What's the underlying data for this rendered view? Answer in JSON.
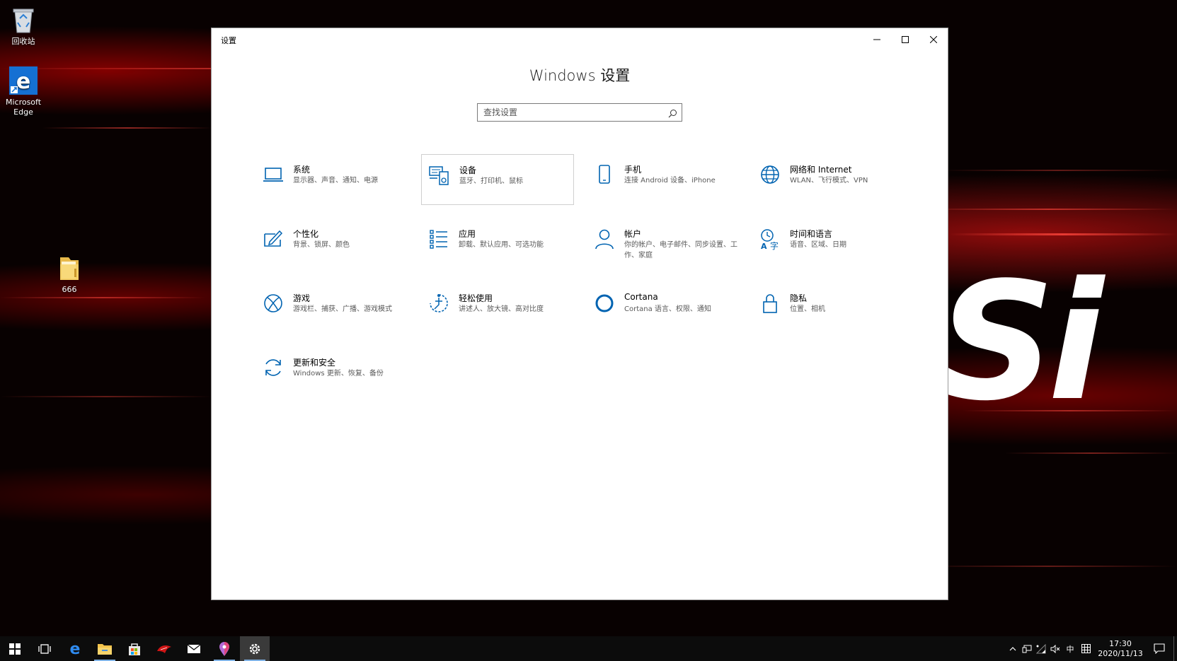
{
  "desktop": {
    "icons": [
      {
        "label": "回收站"
      },
      {
        "label": "Microsoft Edge"
      },
      {
        "label": "666"
      }
    ],
    "wallpaper_brand": "Si"
  },
  "window": {
    "title": "设置",
    "heading": "Windows 设置",
    "search_placeholder": "查找设置",
    "categories": [
      {
        "name": "系统",
        "desc": "显示器、声音、通知、电源",
        "icon": "laptop-icon"
      },
      {
        "name": "设备",
        "desc": "蓝牙、打印机、鼠标",
        "icon": "devices-icon"
      },
      {
        "name": "手机",
        "desc": "连接 Android 设备、iPhone",
        "icon": "phone-icon"
      },
      {
        "name": "网络和 Internet",
        "desc": "WLAN、飞行模式、VPN",
        "icon": "globe-icon"
      },
      {
        "name": "个性化",
        "desc": "背景、锁屏、颜色",
        "icon": "paint-icon"
      },
      {
        "name": "应用",
        "desc": "卸载、默认应用、可选功能",
        "icon": "apps-list-icon"
      },
      {
        "name": "帐户",
        "desc": "你的帐户、电子邮件、同步设置、工作、家庭",
        "icon": "person-icon"
      },
      {
        "name": "时间和语言",
        "desc": "语音、区域、日期",
        "icon": "time-language-icon"
      },
      {
        "name": "游戏",
        "desc": "游戏栏、捕获、广播、游戏模式",
        "icon": "xbox-icon"
      },
      {
        "name": "轻松使用",
        "desc": "讲述人、放大镜、高对比度",
        "icon": "ease-of-access-icon"
      },
      {
        "name": "Cortana",
        "desc": "Cortana 语言、权限、通知",
        "icon": "cortana-icon"
      },
      {
        "name": "隐私",
        "desc": "位置、相机",
        "icon": "lock-icon"
      },
      {
        "name": "更新和安全",
        "desc": "Windows 更新、恢复、备份",
        "icon": "refresh-icon"
      }
    ]
  },
  "taskbar": {
    "tray_ime": "中",
    "time": "17:30",
    "date": "2020/11/13"
  },
  "colors": {
    "accent": "#0063b1",
    "taskbar": "#0c0c0c"
  }
}
